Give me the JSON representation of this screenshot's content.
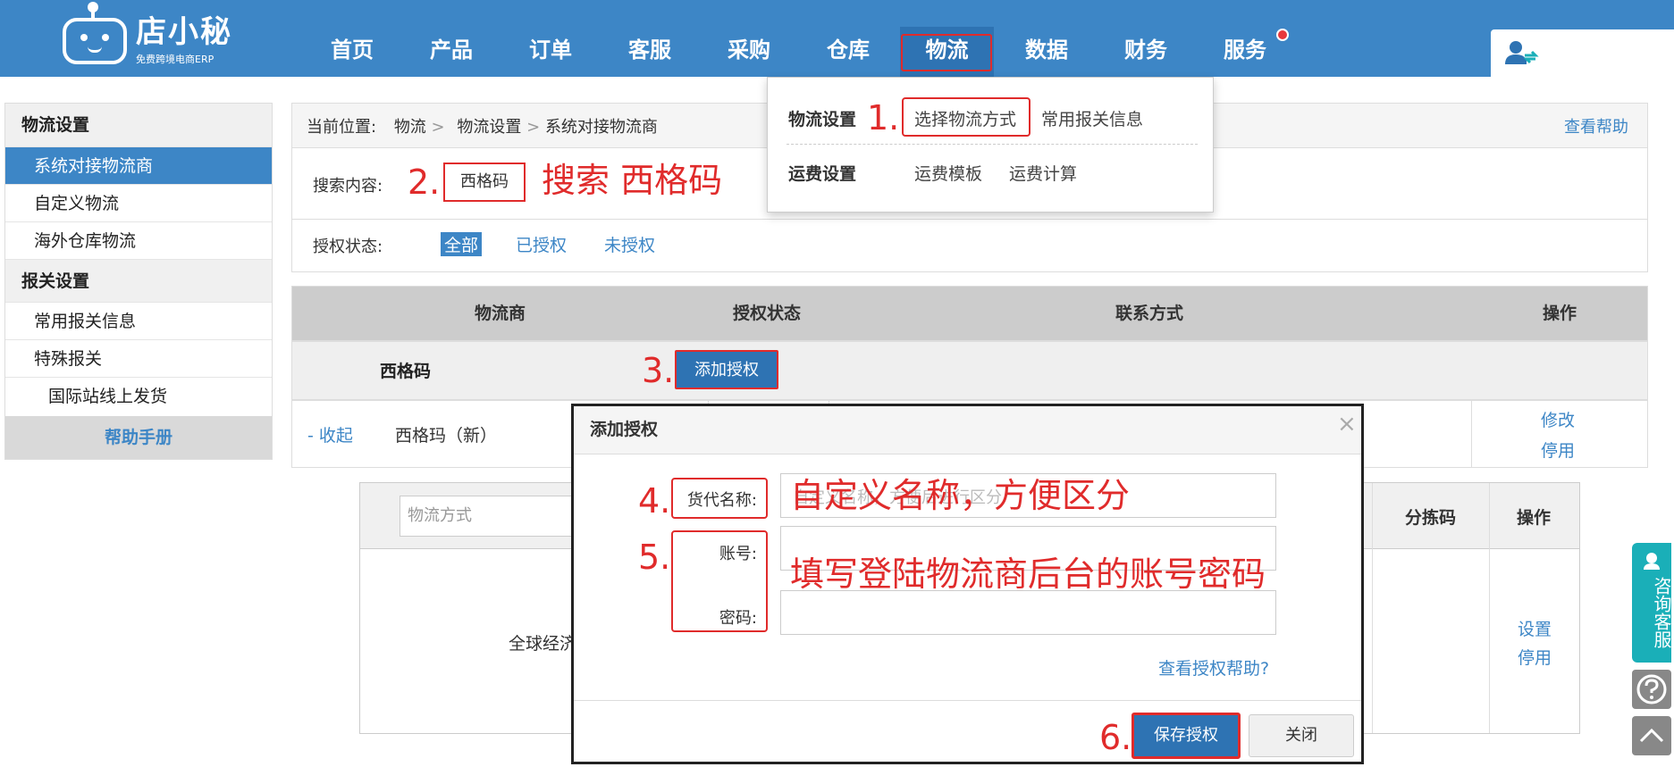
{
  "header": {
    "logo_brand": "店小秘",
    "logo_tagline": "免费跨境电商ERP",
    "nav": [
      "首页",
      "产品",
      "订单",
      "客服",
      "采购",
      "仓库",
      "物流",
      "数据",
      "财务",
      "服务"
    ],
    "active_nav": "物流"
  },
  "dropdown": {
    "logistics_settings_label": "物流设置",
    "select_method": "选择物流方式",
    "customs_info": "常用报关信息",
    "freight_settings_label": "运费设置",
    "freight_template": "运费模板",
    "freight_calc": "运费计算"
  },
  "sidebar": {
    "section1": "物流设置",
    "items1": [
      "系统对接物流商",
      "自定义物流",
      "海外仓库物流"
    ],
    "section2": "报关设置",
    "items2": [
      "常用报关信息",
      "特殊报关"
    ],
    "subitem": "国际站线上发货",
    "help": "帮助手册"
  },
  "breadcrumb": {
    "prefix": "当前位置:",
    "path1": "物流",
    "path2": "物流设置",
    "path3": "系统对接物流商",
    "help_link": "查看帮助"
  },
  "filters": {
    "search_label": "搜索内容:",
    "search_value": "西格码",
    "auth_label": "授权状态:",
    "auth_options": [
      "全部",
      "已授权",
      "未授权"
    ]
  },
  "table": {
    "headers": [
      "物流商",
      "授权状态",
      "联系方式",
      "操作"
    ],
    "group_name": "西格码",
    "add_auth": "添加授权",
    "collapse": "- 收起",
    "sub_name": "西格玛（新）",
    "edit": "修改",
    "disable": "停用"
  },
  "inner_table": {
    "method_placeholder": "物流方式",
    "sort_code": "分拣码",
    "operation": "操作",
    "global_text": "全球经济",
    "set": "设置",
    "disable": "停用"
  },
  "modal": {
    "title": "添加授权",
    "close": "×",
    "name_label": "货代名称:",
    "name_placeholder": "自定义名称，方便后进行区分",
    "account_label": "账号:",
    "password_label": "密码:",
    "help_link": "查看授权帮助?",
    "save": "保存授权",
    "close_btn": "关闭"
  },
  "annotations": {
    "n1": "1.",
    "n2": "2.",
    "t2": "搜索 西格码",
    "n3": "3.",
    "n4": "4.",
    "t4": "自定义名称，方便区分",
    "n5": "5.",
    "t5": "填写登陆物流商后台的账号密码",
    "n6": "6."
  },
  "floating": {
    "consult": "咨询客服"
  },
  "colors": {
    "primary": "#3d86c6",
    "annotation": "#e02b2b",
    "consult": "#1aafb8"
  }
}
